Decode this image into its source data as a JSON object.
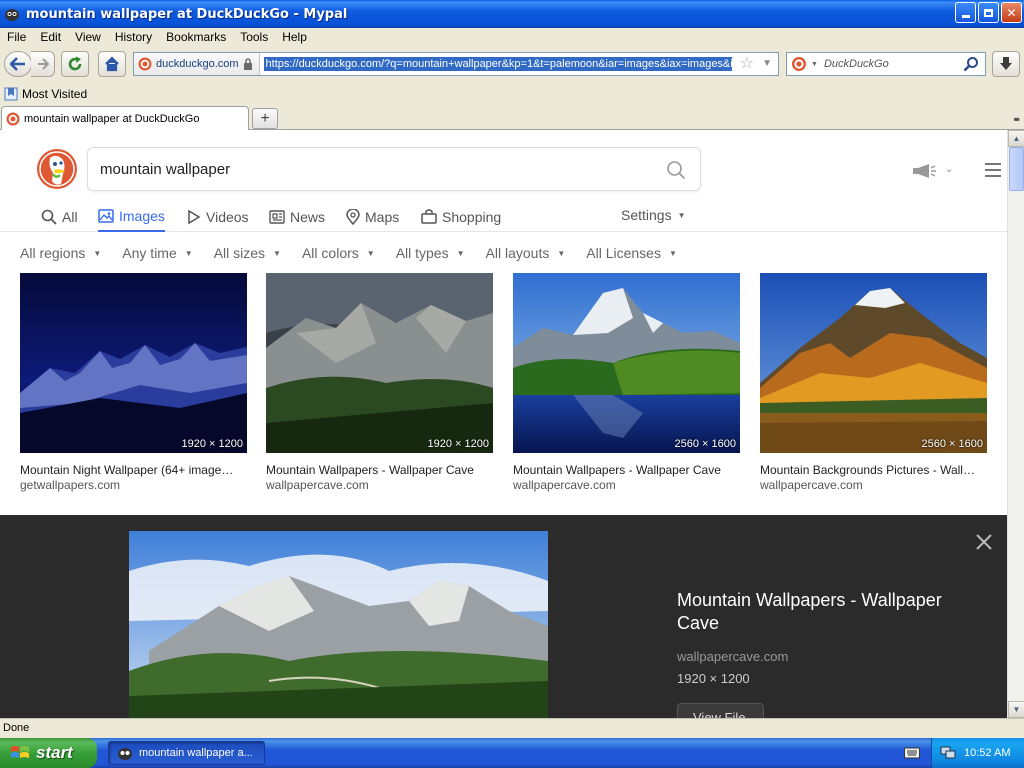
{
  "window": {
    "title": "mountain wallpaper at DuckDuckGo - Mypal"
  },
  "menu": [
    "File",
    "Edit",
    "View",
    "History",
    "Bookmarks",
    "Tools",
    "Help"
  ],
  "nav": {
    "identity": "duckduckgo.com",
    "url": "https://duckduckgo.com/?q=mountain+wallpaper&kp=1&t=palemoon&iar=images&iax=images&i",
    "search_engine": "DuckDuckGo"
  },
  "bookmarks": {
    "most_visited": "Most Visited"
  },
  "tabs": [
    {
      "label": "mountain wallpaper at DuckDuckGo"
    }
  ],
  "ddg": {
    "query": "mountain wallpaper",
    "tabs": [
      {
        "label": "All",
        "icon": "search-icon"
      },
      {
        "label": "Images",
        "icon": "image-icon",
        "active": true
      },
      {
        "label": "Videos",
        "icon": "play-icon"
      },
      {
        "label": "News",
        "icon": "newspaper-icon"
      },
      {
        "label": "Maps",
        "icon": "map-pin-icon"
      },
      {
        "label": "Shopping",
        "icon": "shopping-bag-icon"
      }
    ],
    "settings": "Settings",
    "filters": [
      "All regions",
      "Any time",
      "All sizes",
      "All colors",
      "All types",
      "All layouts",
      "All Licenses"
    ],
    "results": [
      {
        "title": "Mountain Night Wallpaper (64+ image…",
        "source": "getwallpapers.com",
        "dims": "1920 × 1200"
      },
      {
        "title": "Mountain Wallpapers - Wallpaper Cave",
        "source": "wallpapercave.com",
        "dims": "1920 × 1200"
      },
      {
        "title": "Mountain Wallpapers - Wallpaper Cave",
        "source": "wallpapercave.com",
        "dims": "2560 × 1600"
      },
      {
        "title": "Mountain Backgrounds Pictures - Wall…",
        "source": "wallpapercave.com",
        "dims": "2560 × 1600"
      }
    ],
    "detail": {
      "title": "Mountain Wallpapers - Wallpaper Cave",
      "source": "wallpapercave.com",
      "dims": "1920 × 1200",
      "view_file": "View File"
    }
  },
  "status": "Done",
  "taskbar": {
    "start": "start",
    "task": "mountain wallpaper a...",
    "clock": "10:52 AM"
  },
  "colors": {
    "ddg_accent": "#3969ef",
    "ddg_logo": "#de5833",
    "xp_title": "#0752d6",
    "xp_start": "#37a037"
  }
}
